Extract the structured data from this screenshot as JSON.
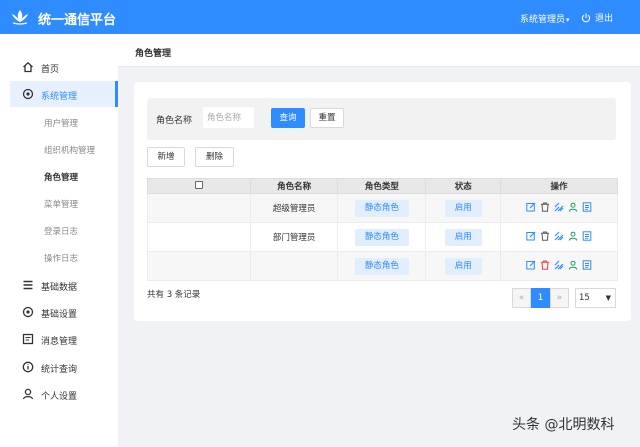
{
  "header": {
    "title": "统一通信平台",
    "user_label": "系统管理员",
    "logout_label": "退出",
    "bg_color": "#2f8cff"
  },
  "sidebar": {
    "items": [
      {
        "label": "首页",
        "icon": "home-icon"
      },
      {
        "label": "系统管理",
        "icon": "gear-icon",
        "active": true,
        "children": [
          {
            "label": "用户管理"
          },
          {
            "label": "组织机构管理"
          },
          {
            "label": "角色管理",
            "current": true
          },
          {
            "label": "菜单管理"
          },
          {
            "label": "登录日志"
          },
          {
            "label": "操作日志"
          }
        ]
      },
      {
        "label": "基础数据",
        "icon": "list-icon"
      },
      {
        "label": "基础设置",
        "icon": "settings-icon"
      },
      {
        "label": "消息管理",
        "icon": "message-icon"
      },
      {
        "label": "统计查询",
        "icon": "info-icon"
      },
      {
        "label": "个人设置",
        "icon": "user-icon"
      }
    ]
  },
  "main": {
    "page_title": "角色管理",
    "search": {
      "label": "角色名称",
      "placeholder": "角色名称",
      "query_button": "查询",
      "reset_button": "重置"
    },
    "actions": {
      "add_button": "新增",
      "delete_button": "删除"
    },
    "table": {
      "columns": [
        "角色名称",
        "角色类型",
        "状态",
        "操作"
      ],
      "rows": [
        {
          "name": "超级管理员",
          "type": "静态角色",
          "status": "启用"
        },
        {
          "name": "部门管理员",
          "type": "静态角色",
          "status": "启用"
        },
        {
          "name": "",
          "type": "静态角色",
          "status": "启用"
        }
      ]
    },
    "footer": {
      "record_count": "共有 3 条记录",
      "prev": "«",
      "current_page": "1",
      "next": "»",
      "page_size": "15"
    }
  },
  "watermark": "头条 @北明数科"
}
